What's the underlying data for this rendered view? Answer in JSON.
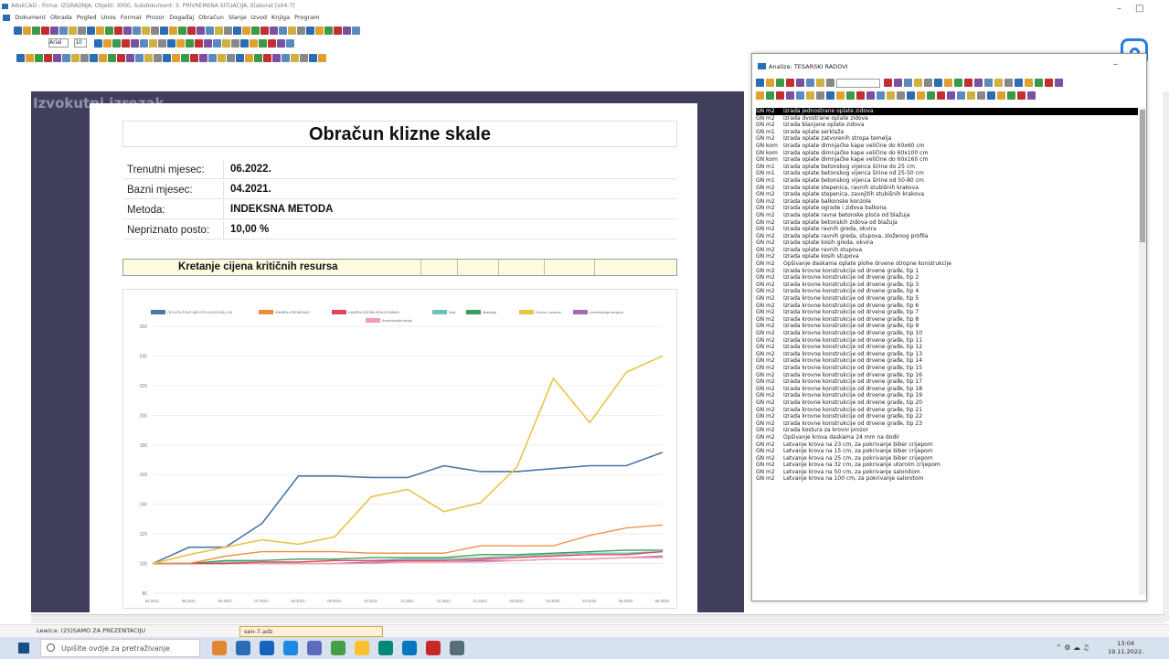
{
  "titlebar": {
    "title": "AdukCAD - Firma: IZGRADNJA, Objekt: 3000, Subdokument: 5. PRIVREMENA SITUACIJA, Elaborat [sit4-7]"
  },
  "menubar": {
    "items": [
      "Dokument",
      "Obrada",
      "Pogled",
      "Unos",
      "Format",
      "Prozor",
      "Događaj",
      "Obračun",
      "Slanje",
      "Izvod",
      "Knjiga",
      "Program"
    ]
  },
  "toolbar": {
    "font_name": "Arial",
    "font_size": "10"
  },
  "faint_text": "Izvokutni izrezak",
  "document": {
    "title": "Obračun klizne skale",
    "rows": [
      {
        "label": "Trenutni mjesec:",
        "value": "06.2022."
      },
      {
        "label": "Bazni mjesec:",
        "value": "04.2021."
      },
      {
        "label": "Metoda:",
        "value": "INDEKSNA METODA"
      },
      {
        "label": "Nepriznato posto:",
        "value": "10,00 %"
      }
    ],
    "section_title": "Kretanje cijena kritičnih resursa"
  },
  "chart_data": {
    "type": "line",
    "categories": [
      "04.2021.",
      "05.2021.",
      "06.2021.",
      "07.2021.",
      "08.2021.",
      "09.2021.",
      "10.2021.",
      "11.2021.",
      "12.2021.",
      "01.2022.",
      "02.2022.",
      "03.2022.",
      "04.2022.",
      "05.2022.",
      "06.2022."
    ],
    "ylim": [
      80,
      260
    ],
    "yticks": [
      80,
      100,
      120,
      140,
      160,
      180,
      200,
      220,
      240,
      260
    ],
    "grid": true,
    "legend_position": "top",
    "series": [
      {
        "name": "OPLATA ŠTAP-MB-STEL(100X100)-CM",
        "color": "#4a77a8",
        "values": [
          100,
          111,
          111,
          127,
          159,
          159,
          158,
          158,
          166,
          162,
          162,
          164,
          166,
          166,
          175
        ]
      },
      {
        "name": "KAMEN-KREMENAC",
        "color": "#f08a3c",
        "values": [
          100,
          100,
          105,
          108,
          108,
          108,
          107,
          107,
          107,
          112,
          112,
          112,
          119,
          124,
          126
        ]
      },
      {
        "name": "KAMEN-DROBLJENI-DIJABAS",
        "color": "#e0475b",
        "values": [
          100,
          100,
          100,
          101,
          101,
          102,
          102,
          102,
          102,
          103,
          104,
          105,
          106,
          106,
          108
        ]
      },
      {
        "name": "Rad",
        "color": "#6fc0b8",
        "values": [
          100,
          100,
          101,
          101,
          101,
          102,
          102,
          103,
          103,
          104,
          105,
          106,
          107,
          107,
          108
        ]
      },
      {
        "name": "Materijal",
        "color": "#3f9a5b",
        "values": [
          100,
          100,
          102,
          102,
          103,
          103,
          104,
          104,
          104,
          106,
          106,
          107,
          108,
          109,
          109
        ]
      },
      {
        "name": "Goriva i maziva",
        "color": "#e8c547",
        "values": [
          100,
          106,
          111,
          116,
          113,
          118,
          145,
          150,
          135,
          141,
          165,
          225,
          195,
          229,
          240
        ]
      },
      {
        "name": "Amortizacija strojeva",
        "color": "#a36bb0",
        "values": [
          100,
          100,
          100,
          100,
          100,
          100,
          101,
          101,
          101,
          102,
          102,
          103,
          103,
          104,
          105
        ]
      },
      {
        "name": "Amortizacija stroja",
        "color": "#f19cb0",
        "values": [
          100,
          100,
          100,
          100,
          100,
          100,
          100,
          101,
          101,
          101,
          102,
          103,
          103,
          104,
          104
        ]
      }
    ]
  },
  "panel": {
    "title": "Analize: TESARSKI RADOVI",
    "items": [
      {
        "unit": "GN m2",
        "text": "Izrada jednostrane oplate zidova"
      },
      {
        "unit": "GN m2",
        "text": "Izrada dvostrane oplate zidova"
      },
      {
        "unit": "GN m2",
        "text": "Izrada blanjane oplate zidova"
      },
      {
        "unit": "GN m1",
        "text": "Izrada oplate serklaža"
      },
      {
        "unit": "GN m2",
        "text": "Izrada oplate zatvorenih stropa temelja"
      },
      {
        "unit": "GN kom",
        "text": "Izrada oplate dimnjačke kape veličine do 60x60 cm"
      },
      {
        "unit": "GN kom",
        "text": "Izrada oplate dimnjačke kape veličine do 60x100 cm"
      },
      {
        "unit": "GN kom",
        "text": "Izrada oplate dimnjačke kape veličine do 60x160 cm"
      },
      {
        "unit": "GN m1",
        "text": "Izrada oplate betonskog vijenca širine do 25 cm"
      },
      {
        "unit": "GN m1",
        "text": "Izrada oplate betonskog vijenca širine od 25-50 cm"
      },
      {
        "unit": "GN m1",
        "text": "Izrada oplate betonskog vijenca širine od 50-80 cm"
      },
      {
        "unit": "GN m2",
        "text": "Izrada oplate stepenica, ravnih stubišnih krakova"
      },
      {
        "unit": "GN m2",
        "text": "Izrada oplate stepenica, zavojitih stubišnih krakova"
      },
      {
        "unit": "GN m2",
        "text": "Izrada oplate balkonske konzole"
      },
      {
        "unit": "GN m2",
        "text": "Izrada oplate ograde i zidova balkona"
      },
      {
        "unit": "GN m2",
        "text": "Izrada oplate ravne betonske ploče od blažuja"
      },
      {
        "unit": "GN m2",
        "text": "Izrada oplate betonskih zidova od blažuja"
      },
      {
        "unit": "GN m2",
        "text": "Izrada oplate ravnih greda, okvira"
      },
      {
        "unit": "GN m2",
        "text": "Izrada oplate ravnih greda, stupova, složenog profila"
      },
      {
        "unit": "GN m2",
        "text": "Izrada oplate kosih greda, okvira"
      },
      {
        "unit": "GN m2",
        "text": "Izrada oplate ravnih stupova"
      },
      {
        "unit": "GN m2",
        "text": "Izrada oplate kosih stupova"
      },
      {
        "unit": "GN m2",
        "text": "Opšivanje daskama oplate plohe drvene stropne konstrukcije"
      },
      {
        "unit": "GN m2",
        "text": "Izrada krovne konstrukcije od drvene građe, tip 1"
      },
      {
        "unit": "GN m2",
        "text": "Izrada krovne konstrukcije od drvene građe, tip 2"
      },
      {
        "unit": "GN m2",
        "text": "Izrada krovne konstrukcije od drvene građe, tip 3"
      },
      {
        "unit": "GN m2",
        "text": "Izrada krovne konstrukcije od drvene građe, tip 4"
      },
      {
        "unit": "GN m2",
        "text": "Izrada krovne konstrukcije od drvene građe, tip 5"
      },
      {
        "unit": "GN m2",
        "text": "Izrada krovne konstrukcije od drvene građe, tip 6"
      },
      {
        "unit": "GN m2",
        "text": "Izrada krovne konstrukcije od drvene građe, tip 7"
      },
      {
        "unit": "GN m2",
        "text": "Izrada krovne konstrukcije od drvene građe, tip 8"
      },
      {
        "unit": "GN m2",
        "text": "Izrada krovne konstrukcije od drvene građe, tip 9"
      },
      {
        "unit": "GN m2",
        "text": "Izrada krovne konstrukcije od drvene građe, tip 10"
      },
      {
        "unit": "GN m2",
        "text": "Izrada krovne konstrukcije od drvene građe, tip 11"
      },
      {
        "unit": "GN m2",
        "text": "Izrada krovne konstrukcije od drvene građe, tip 12"
      },
      {
        "unit": "GN m2",
        "text": "Izrada krovne konstrukcije od drvene građe, tip 13"
      },
      {
        "unit": "GN m2",
        "text": "Izrada krovne konstrukcije od drvene građe, tip 14"
      },
      {
        "unit": "GN m2",
        "text": "Izrada krovne konstrukcije od drvene građe, tip 15"
      },
      {
        "unit": "GN m2",
        "text": "Izrada krovne konstrukcije od drvene građe, tip 16"
      },
      {
        "unit": "GN m2",
        "text": "Izrada krovne konstrukcije od drvene građe, tip 17"
      },
      {
        "unit": "GN m2",
        "text": "Izrada krovne konstrukcije od drvene građe, tip 18"
      },
      {
        "unit": "GN m2",
        "text": "Izrada krovne konstrukcije od drvene građe, tip 19"
      },
      {
        "unit": "GN m2",
        "text": "Izrada krovne konstrukcije od drvene građe, tip 20"
      },
      {
        "unit": "GN m2",
        "text": "Izrada krovne konstrukcije od drvene građe, tip 21"
      },
      {
        "unit": "GN m2",
        "text": "Izrada krovne konstrukcije od drvene građe, tip 22"
      },
      {
        "unit": "GN m2",
        "text": "Izrada krovne konstrukcije od drvene građe, tip 23"
      },
      {
        "unit": "GN m2",
        "text": "Izrada kostura za krovni prozor"
      },
      {
        "unit": "GN m2",
        "text": "Opšivanje krova daskama 24 mm na dodir"
      },
      {
        "unit": "GN m2",
        "text": "Letvanje krova na 23 cm, za pokrivanje biber crijepom"
      },
      {
        "unit": "GN m2",
        "text": "Letvanje krova na 15 cm, za pokrivanje biber crijepom"
      },
      {
        "unit": "GN m2",
        "text": "Letvanje krova na 25 cm, za pokrivanje biber crijepom"
      },
      {
        "unit": "GN m2",
        "text": "Letvanje krova na 32 cm, za pokrivanje utorním crijepom"
      },
      {
        "unit": "GN m2",
        "text": "Letvanje krova na 50 cm, za pokrivanje salonitom"
      },
      {
        "unit": "GN m2",
        "text": "Letvanje krova na 100 cm, za pokrivanje salonitom"
      }
    ]
  },
  "statusbar": {
    "text": "Lewica: (25)SAMO ZA PREZENTACIJU",
    "tab": "sen-7.adz"
  },
  "taskbar": {
    "search_placeholder": "Upišite ovdje za pretraživanje",
    "time": "13:04",
    "date": "19.11.2022."
  }
}
